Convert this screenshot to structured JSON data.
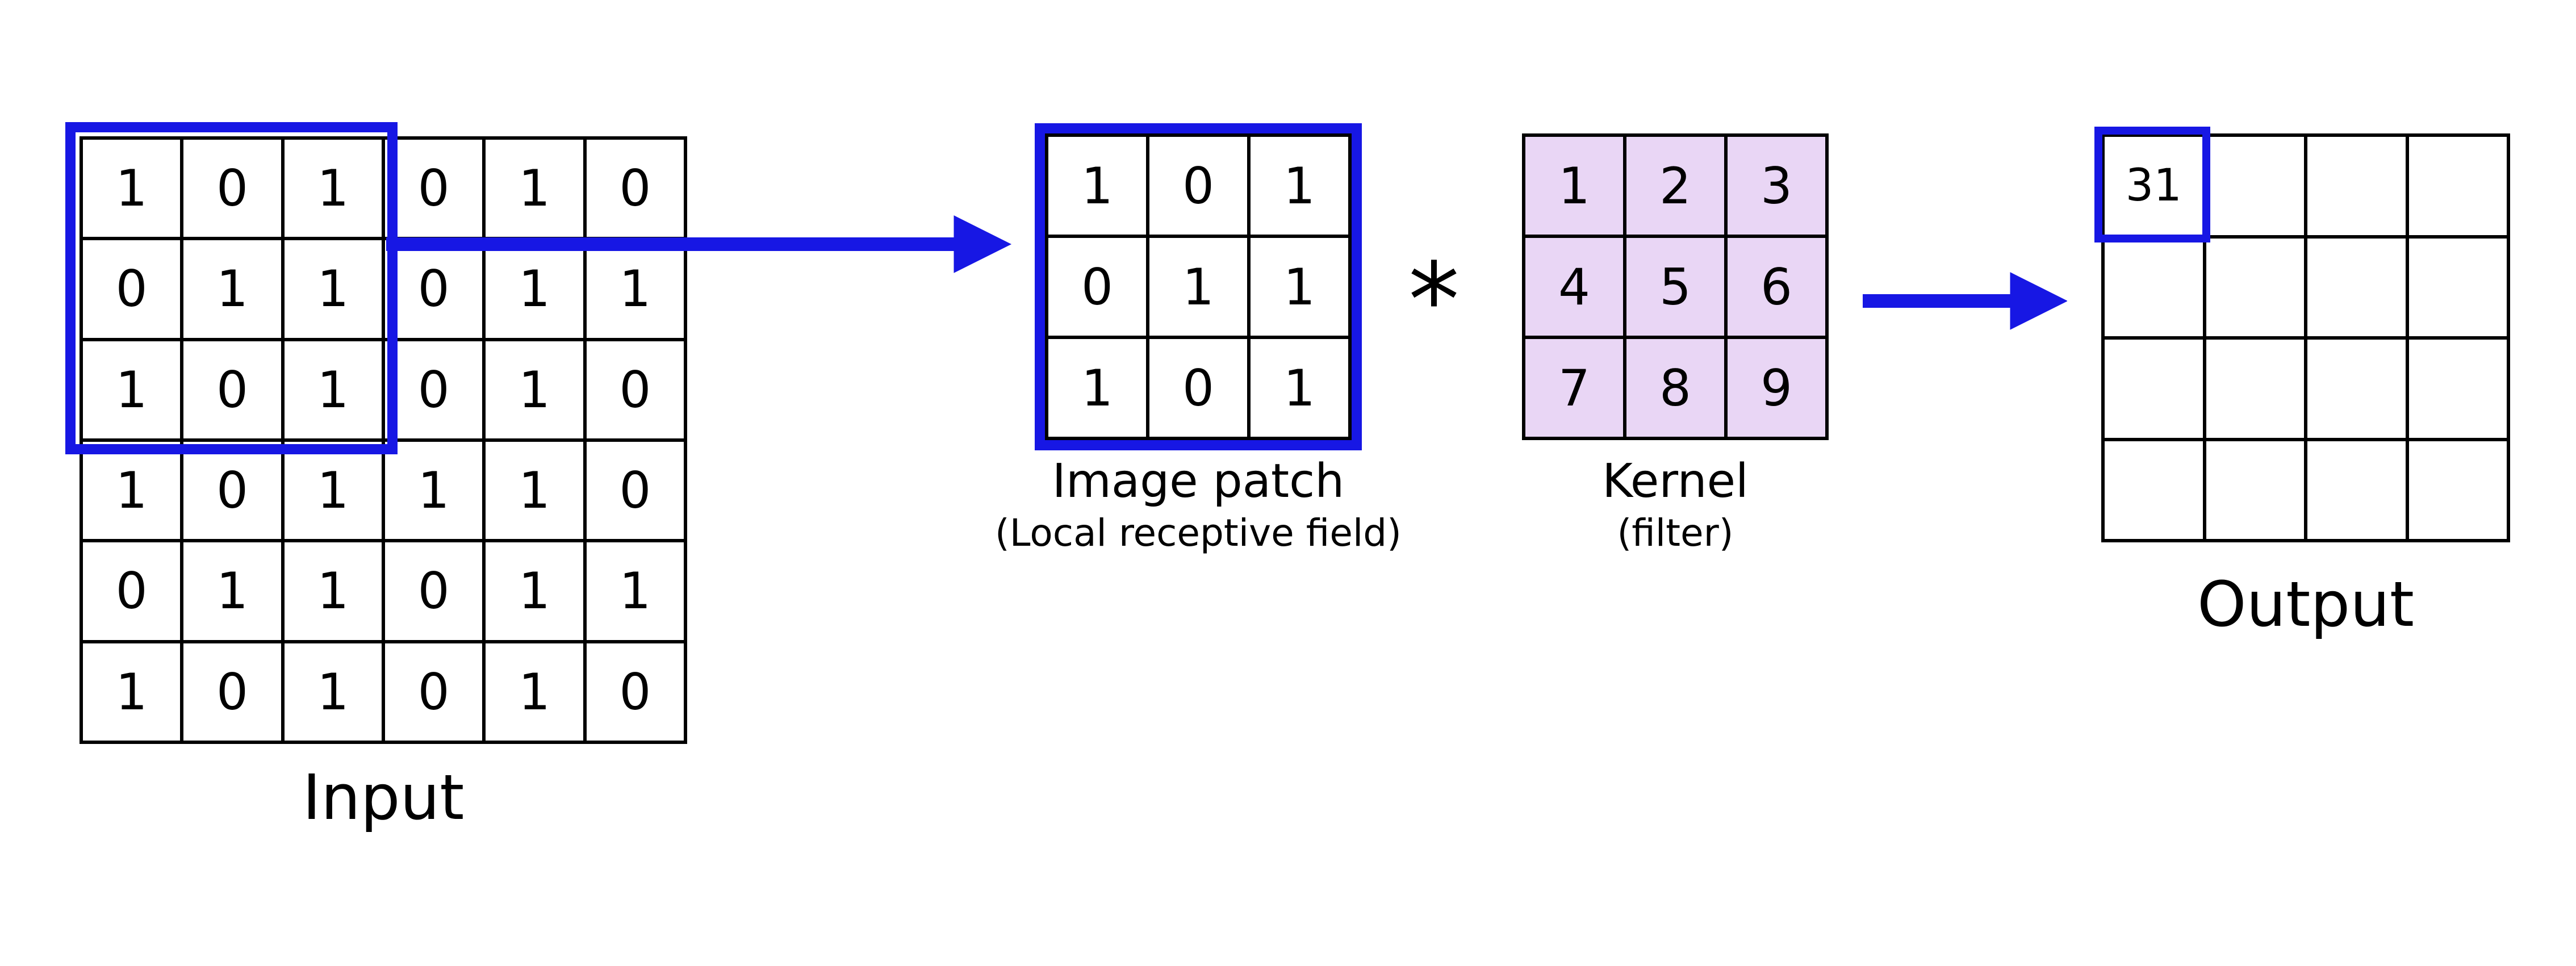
{
  "input": {
    "label": "Input",
    "rows": 6,
    "cols": 6,
    "values": [
      [
        1,
        0,
        1,
        0,
        1,
        0
      ],
      [
        0,
        1,
        1,
        0,
        1,
        1
      ],
      [
        1,
        0,
        1,
        0,
        1,
        0
      ],
      [
        1,
        0,
        1,
        1,
        1,
        0
      ],
      [
        0,
        1,
        1,
        0,
        1,
        1
      ],
      [
        1,
        0,
        1,
        0,
        1,
        0
      ]
    ]
  },
  "patch": {
    "label": "Image patch",
    "sublabel": "(Local receptive field)",
    "rows": 3,
    "cols": 3,
    "values": [
      [
        1,
        0,
        1
      ],
      [
        0,
        1,
        1
      ],
      [
        1,
        0,
        1
      ]
    ]
  },
  "kernel": {
    "label": "Kernel",
    "sublabel": "(filter)",
    "rows": 3,
    "cols": 3,
    "values": [
      [
        1,
        2,
        3
      ],
      [
        4,
        5,
        6
      ],
      [
        7,
        8,
        9
      ]
    ]
  },
  "output": {
    "label": "Output",
    "rows": 4,
    "cols": 4,
    "values": [
      [
        "31",
        "",
        "",
        ""
      ],
      [
        "",
        "",
        "",
        ""
      ],
      [
        "",
        "",
        "",
        ""
      ],
      [
        "",
        "",
        "",
        ""
      ]
    ]
  },
  "operator": "*",
  "colors": {
    "accent": "#1717e4",
    "kernel_bg": "#e9d6f5"
  }
}
